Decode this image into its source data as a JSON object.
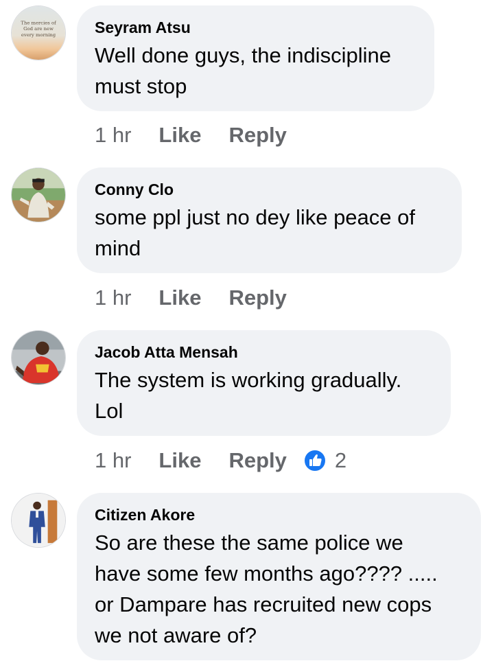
{
  "comments": [
    {
      "author": "Seyram Atsu",
      "text_lines": [
        "Well done guys, the indiscipline",
        "must stop"
      ],
      "time": "1 hr",
      "like_label": "Like",
      "reply_label": "Reply",
      "avatar_text": [
        "The mercies of",
        "God are new",
        "every morning"
      ]
    },
    {
      "author": "Conny Clo",
      "text_lines": [
        "some ppl just no dey like peace of",
        "mind"
      ],
      "time": "1 hr",
      "like_label": "Like",
      "reply_label": "Reply"
    },
    {
      "author": "Jacob Atta Mensah",
      "text_lines": [
        "The system is working gradually.",
        "Lol"
      ],
      "time": "1 hr",
      "like_label": "Like",
      "reply_label": "Reply",
      "reaction_count": "2",
      "reaction_icon": "thumbs-up-icon",
      "reaction_color": "#1877f2"
    },
    {
      "author": "Citizen Akore",
      "text_lines": [
        "So are these the same police we",
        "have some few months ago???? .....",
        "or Dampare has recruited new cops",
        "we not aware of?"
      ]
    }
  ],
  "colors": {
    "bubble_bg": "#f0f2f5",
    "action_text": "#65676b",
    "body_text": "#050505"
  }
}
